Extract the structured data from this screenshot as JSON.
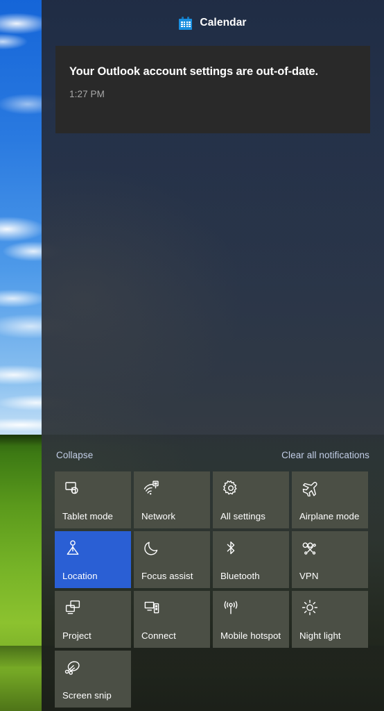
{
  "desktop": {
    "wallpaper_name": "bliss-wallpaper"
  },
  "action_center": {
    "notification_group": {
      "app_icon": "calendar-icon",
      "app_name": "Calendar",
      "notifications": [
        {
          "title": "Your Outlook account settings are out-of-date.",
          "time": "1:27 PM"
        }
      ]
    },
    "links": {
      "collapse": "Collapse",
      "clear_all": "Clear all notifications"
    },
    "quick_actions": [
      {
        "label": "Tablet mode",
        "icon": "tablet-mode-icon",
        "active": false
      },
      {
        "label": "Network",
        "icon": "network-icon",
        "active": false
      },
      {
        "label": "All settings",
        "icon": "gear-icon",
        "active": false
      },
      {
        "label": "Airplane mode",
        "icon": "airplane-icon",
        "active": false
      },
      {
        "label": "Location",
        "icon": "location-icon",
        "active": true
      },
      {
        "label": "Focus assist",
        "icon": "moon-icon",
        "active": false
      },
      {
        "label": "Bluetooth",
        "icon": "bluetooth-icon",
        "active": false
      },
      {
        "label": "VPN",
        "icon": "vpn-icon",
        "active": false
      },
      {
        "label": "Project",
        "icon": "project-icon",
        "active": false
      },
      {
        "label": "Connect",
        "icon": "connect-icon",
        "active": false
      },
      {
        "label": "Mobile hotspot",
        "icon": "mobile-hotspot-icon",
        "active": false
      },
      {
        "label": "Night light",
        "icon": "brightness-icon",
        "active": false
      },
      {
        "label": "Screen snip",
        "icon": "screen-snip-icon",
        "active": false
      }
    ],
    "colors": {
      "tile_inactive": "#4b4f45",
      "tile_active": "#2a5fd4",
      "link": "#c3cfe8",
      "notification_card": "#292929",
      "accent_blue": "#1a8fe0"
    }
  }
}
